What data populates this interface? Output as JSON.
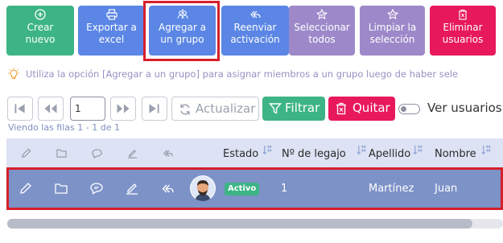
{
  "toolbar": {
    "buttons": [
      {
        "label": "Crear\nnuevo",
        "color": "#3db485"
      },
      {
        "label": "Exportar a\nexcel",
        "color": "#5b86e5"
      },
      {
        "label": "Agregar a\nun grupo",
        "color": "#5b86e5"
      },
      {
        "label": "Reenviar\nactivación",
        "color": "#5b86e5"
      },
      {
        "label": "Seleccionar\ntodos",
        "color": "#9d89c9"
      },
      {
        "label": "Limpiar la\nselección",
        "color": "#9d89c9"
      },
      {
        "label": "Eliminar\nusuarios",
        "color": "#e8185c"
      }
    ],
    "highlight_color": "#d61f2b"
  },
  "hint": {
    "text": "Utiliza la opción [Agregar a un grupo] para asignar miembros a un grupo luego de haber sele"
  },
  "pager": {
    "page_value": "1",
    "refresh_label": "Actualizar",
    "filter_label": "Filtrar",
    "remove_label": "Quitar",
    "toggle_label": "Ver usuarios e",
    "rows_info": "Viendo las filas 1 - 1 de 1"
  },
  "table": {
    "columns": [
      "Estado",
      "Nº de legajo",
      "Apellido",
      "Nombre"
    ],
    "rows": [
      {
        "status": "Activo",
        "legajo": "1",
        "apellido": "Martínez",
        "nombre": "Juan"
      }
    ],
    "row_color": "#7d92c7",
    "status_color": "#3db485"
  },
  "icons": {
    "row_actions": [
      "pencil-icon",
      "folder-icon",
      "comment-icon",
      "signature-icon",
      "reply-all-icon"
    ]
  }
}
